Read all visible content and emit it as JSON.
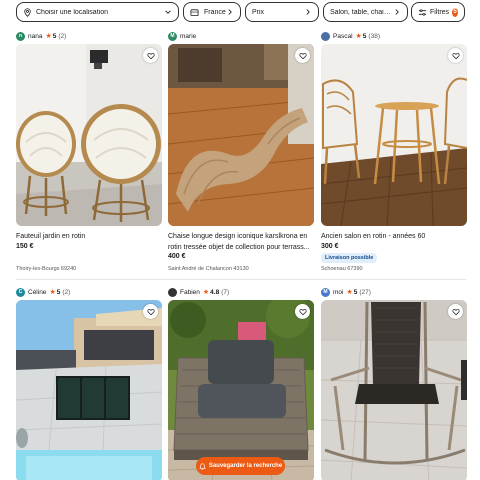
{
  "filters": {
    "location_placeholder": "Choisir une localisation",
    "country": "France",
    "price": "Prix",
    "category": "Salon, table, chai…",
    "more_filters": "Filtres",
    "filters_count": "5"
  },
  "listings": [
    {
      "seller": "nana",
      "avatar_letter": "n",
      "avatar_color": "#2a8a63",
      "rating": "5",
      "reviews": "(2)",
      "title_lines": [
        "Fauteuil jardin en rotin"
      ],
      "price": "150 €",
      "location": "Thoiry-les-Bourgs 69240",
      "badge": ""
    },
    {
      "seller": "marie",
      "avatar_letter": "M",
      "avatar_color": "#2a8a63",
      "rating": "",
      "reviews": "",
      "title_lines": [
        "Chaise longue design iconique karslkrona en",
        "rotin tressée objet de collection pour terrass..."
      ],
      "price": "400 €",
      "location": "Saint André de Chalancon 43130",
      "badge": ""
    },
    {
      "seller": "Pascal",
      "avatar_letter": "",
      "avatar_color": "#4a6fa5",
      "rating": "5",
      "reviews": "(38)",
      "title_lines": [
        "Ancien salon en rotin - années 60"
      ],
      "price": "300 €",
      "location": "Schoenau 67390",
      "badge": "Livraison possible"
    },
    {
      "seller": "Céline",
      "avatar_letter": "C",
      "avatar_color": "#1f8a9b",
      "rating": "5",
      "reviews": "(2)"
    },
    {
      "seller": "Fabien",
      "avatar_letter": "",
      "avatar_color": "#333333",
      "rating": "4.8",
      "reviews": "(7)"
    },
    {
      "seller": "moi",
      "avatar_letter": "M",
      "avatar_color": "#4a78c9",
      "rating": "5",
      "reviews": "(27)"
    }
  ],
  "save_search": "Sauvegarder la recherche",
  "colors": {
    "accent": "#ec5a13",
    "delivery_chip_bg": "#e0eefc",
    "delivery_chip_text": "#124a8a"
  },
  "icons": [
    "location-pin-icon",
    "chevron-down-icon",
    "chevron-right-icon",
    "filters-icon",
    "heart-icon",
    "star-icon",
    "bell-icon"
  ]
}
